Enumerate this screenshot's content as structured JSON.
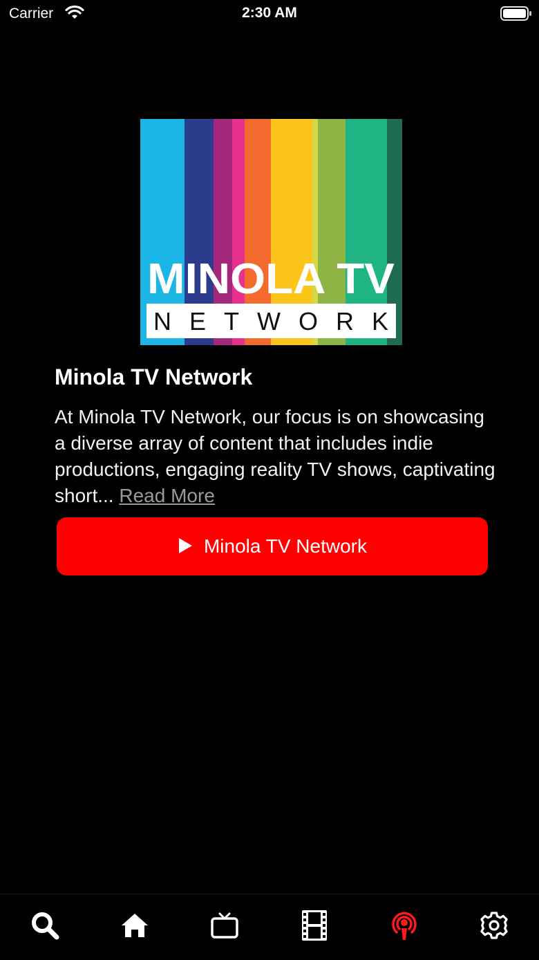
{
  "status_bar": {
    "carrier": "Carrier",
    "time": "2:30 AM"
  },
  "logo": {
    "line1": "MINOLA TV",
    "line2": "NETWORK",
    "stripe_colors": [
      "#1bb5e6",
      "#2b3c8c",
      "#a3277a",
      "#e8318f",
      "#f26a2d",
      "#fbc51b",
      "#d3d84a",
      "#8fb446",
      "#20b383",
      "#1e6a53"
    ]
  },
  "channel": {
    "title": "Minola TV Network",
    "description": "At Minola TV Network, our focus is on showcasing a diverse array of content that includes indie productions, engaging reality TV shows, captivating short...",
    "read_more": "Read More",
    "watch_button_label": "Minola TV Network"
  },
  "tab_bar": {
    "items": [
      {
        "icon": "search-icon",
        "active": false
      },
      {
        "icon": "home-icon",
        "active": false
      },
      {
        "icon": "tv-icon",
        "active": false
      },
      {
        "icon": "film-icon",
        "active": false
      },
      {
        "icon": "podcast-icon",
        "active": true
      },
      {
        "icon": "gear-icon",
        "active": false
      }
    ]
  },
  "colors": {
    "accent": "#ff0000",
    "background": "#000000",
    "text": "#ffffff",
    "muted": "#9a9a9a"
  }
}
